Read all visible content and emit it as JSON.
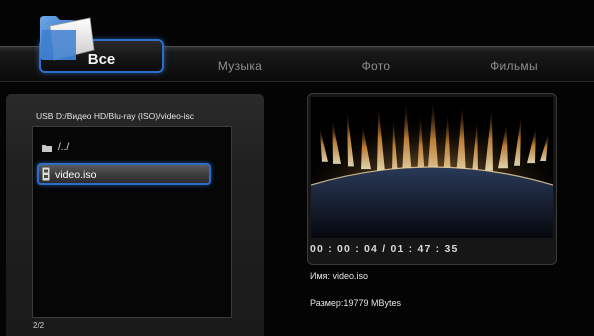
{
  "tabs": [
    {
      "id": "all",
      "label": "Все",
      "active": true
    },
    {
      "id": "music",
      "label": "Музыка",
      "active": false
    },
    {
      "id": "photo",
      "label": "Фото",
      "active": false
    },
    {
      "id": "movies",
      "label": "Фильмы",
      "active": false
    }
  ],
  "browser": {
    "path": "USB D:/Видео HD/Blu-ray (ISO)/video-isc",
    "items": [
      {
        "label": "/../",
        "icon": "folder-icon",
        "selected": false
      },
      {
        "label": "video.iso",
        "icon": "disc-file-icon",
        "selected": true
      }
    ],
    "page": "2/2"
  },
  "preview": {
    "time": "00 : 00 : 04 / 01 : 47 : 35",
    "name": "Имя: video.iso",
    "size": "Размер:19779 MBytes"
  },
  "colors": {
    "accent": "#2b6fc9",
    "background": "#040404",
    "panel": "#202020"
  }
}
